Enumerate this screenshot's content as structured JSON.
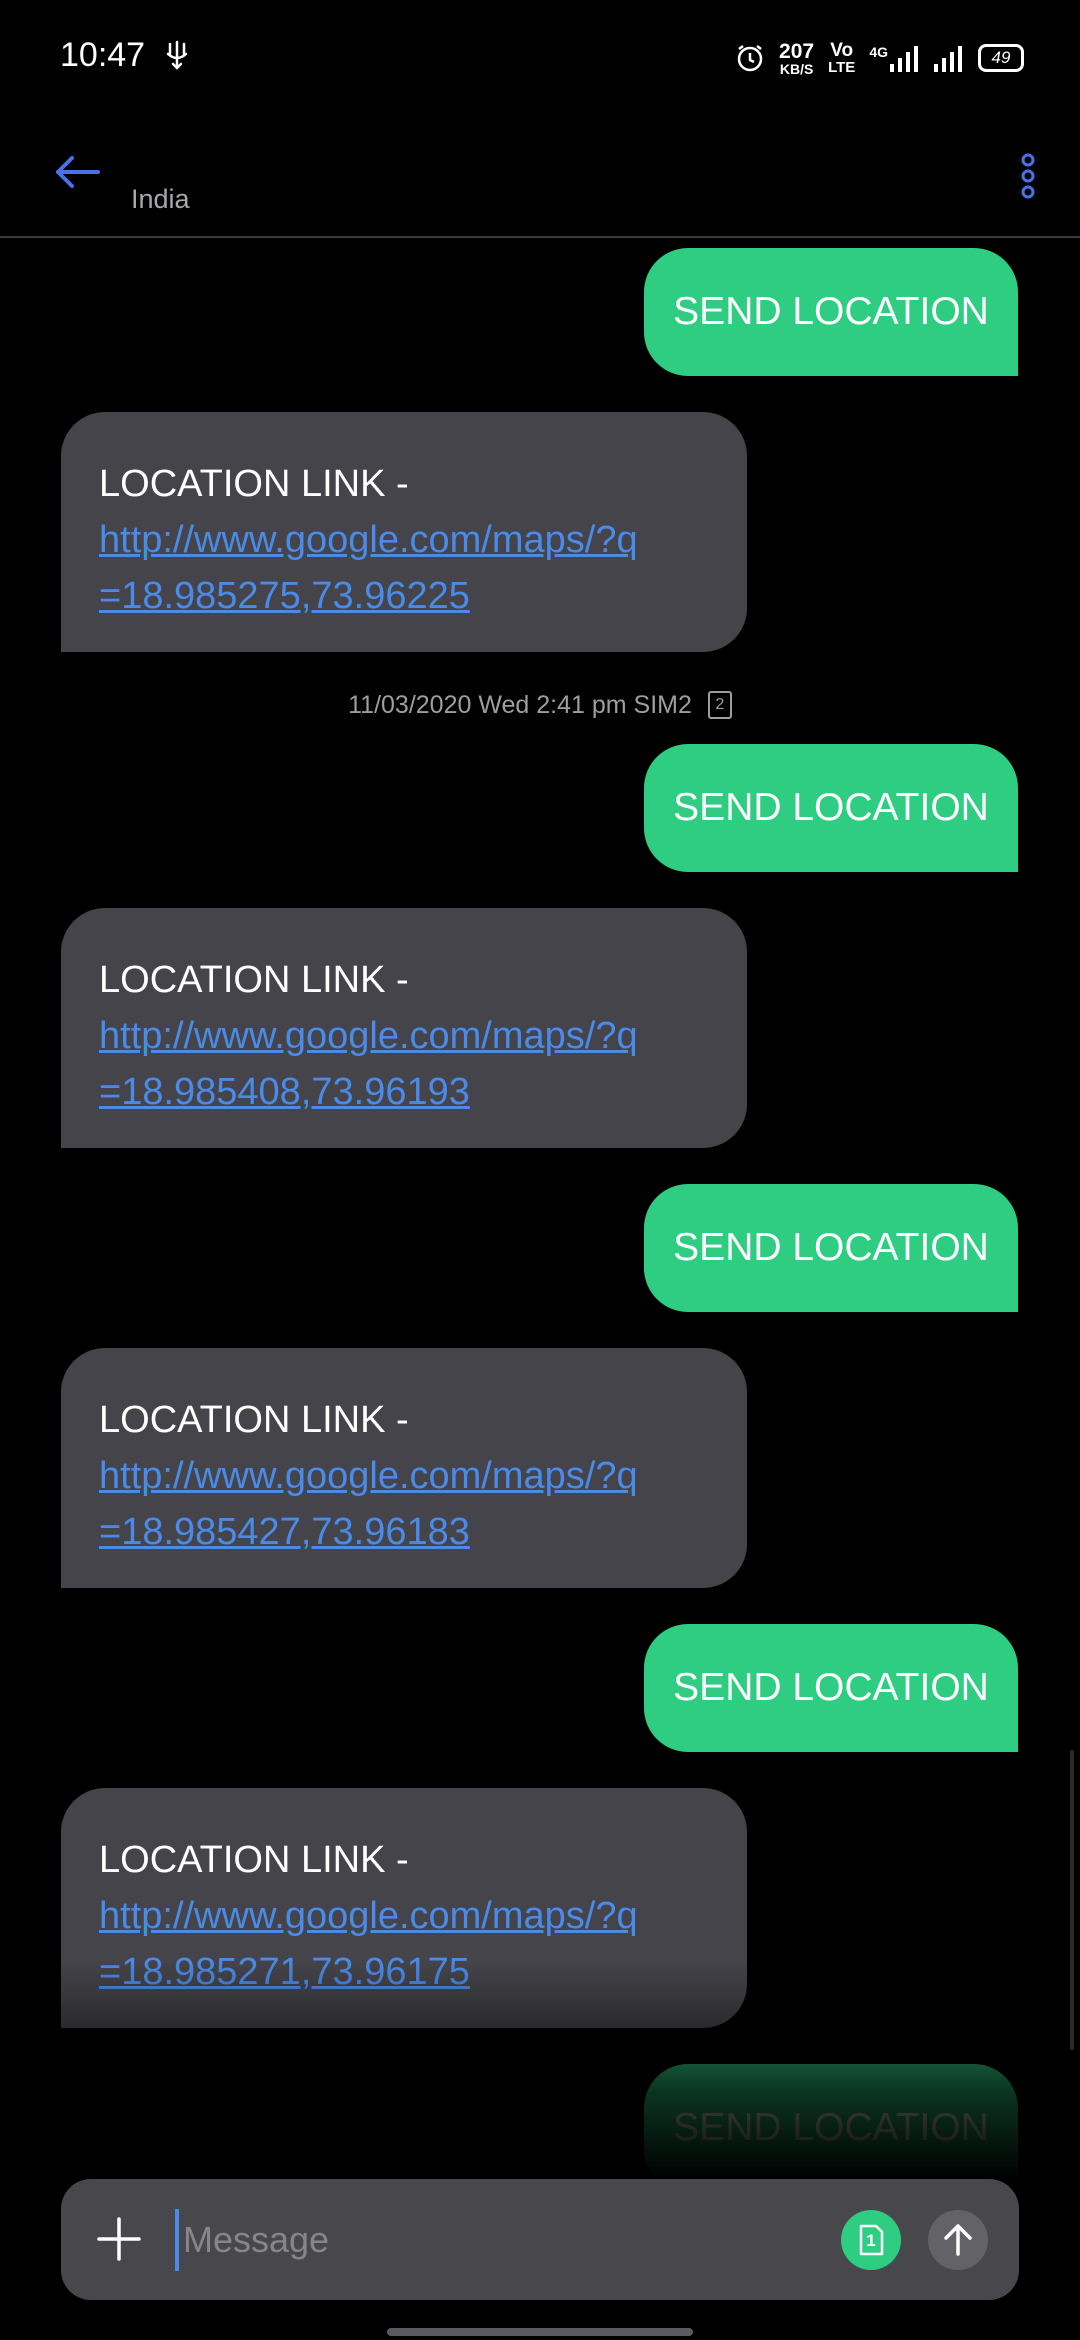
{
  "status_bar": {
    "time": "10:47",
    "net_speed": "207",
    "net_unit": "KB/S",
    "volte_top": "Vo",
    "volte_bottom": "LTE",
    "network_type": "4G",
    "battery": "49"
  },
  "header": {
    "subtitle": "India"
  },
  "messages": [
    {
      "direction": "out",
      "text": "SEND LOCATION"
    },
    {
      "direction": "in",
      "label": "LOCATION LINK -",
      "link_line1": "http://www.google.com/maps/?q",
      "link_line2": "=18.985275,73.96225"
    },
    {
      "direction": "out",
      "text": "SEND LOCATION"
    },
    {
      "direction": "in",
      "label": "LOCATION LINK -",
      "link_line1": "http://www.google.com/maps/?q",
      "link_line2": "=18.985408,73.96193"
    },
    {
      "direction": "out",
      "text": "SEND LOCATION"
    },
    {
      "direction": "in",
      "label": "LOCATION LINK -",
      "link_line1": "http://www.google.com/maps/?q",
      "link_line2": "=18.985427,73.96183"
    },
    {
      "direction": "out",
      "text": "SEND LOCATION"
    },
    {
      "direction": "in",
      "label": "LOCATION LINK -",
      "link_line1": "http://www.google.com/maps/?q",
      "link_line2": "=18.985271,73.96175"
    },
    {
      "direction": "out",
      "text": "SEND LOCATION"
    }
  ],
  "timestamp": {
    "text": "11/03/2020 Wed 2:41 pm  SIM2",
    "sim_number": "2"
  },
  "composer": {
    "placeholder": "Message",
    "sim_number": "1"
  },
  "colors": {
    "outgoing_bubble": "#2ecd82",
    "incoming_bubble": "#44444a",
    "link": "#4a8ae8",
    "accent": "#4a72e8"
  }
}
